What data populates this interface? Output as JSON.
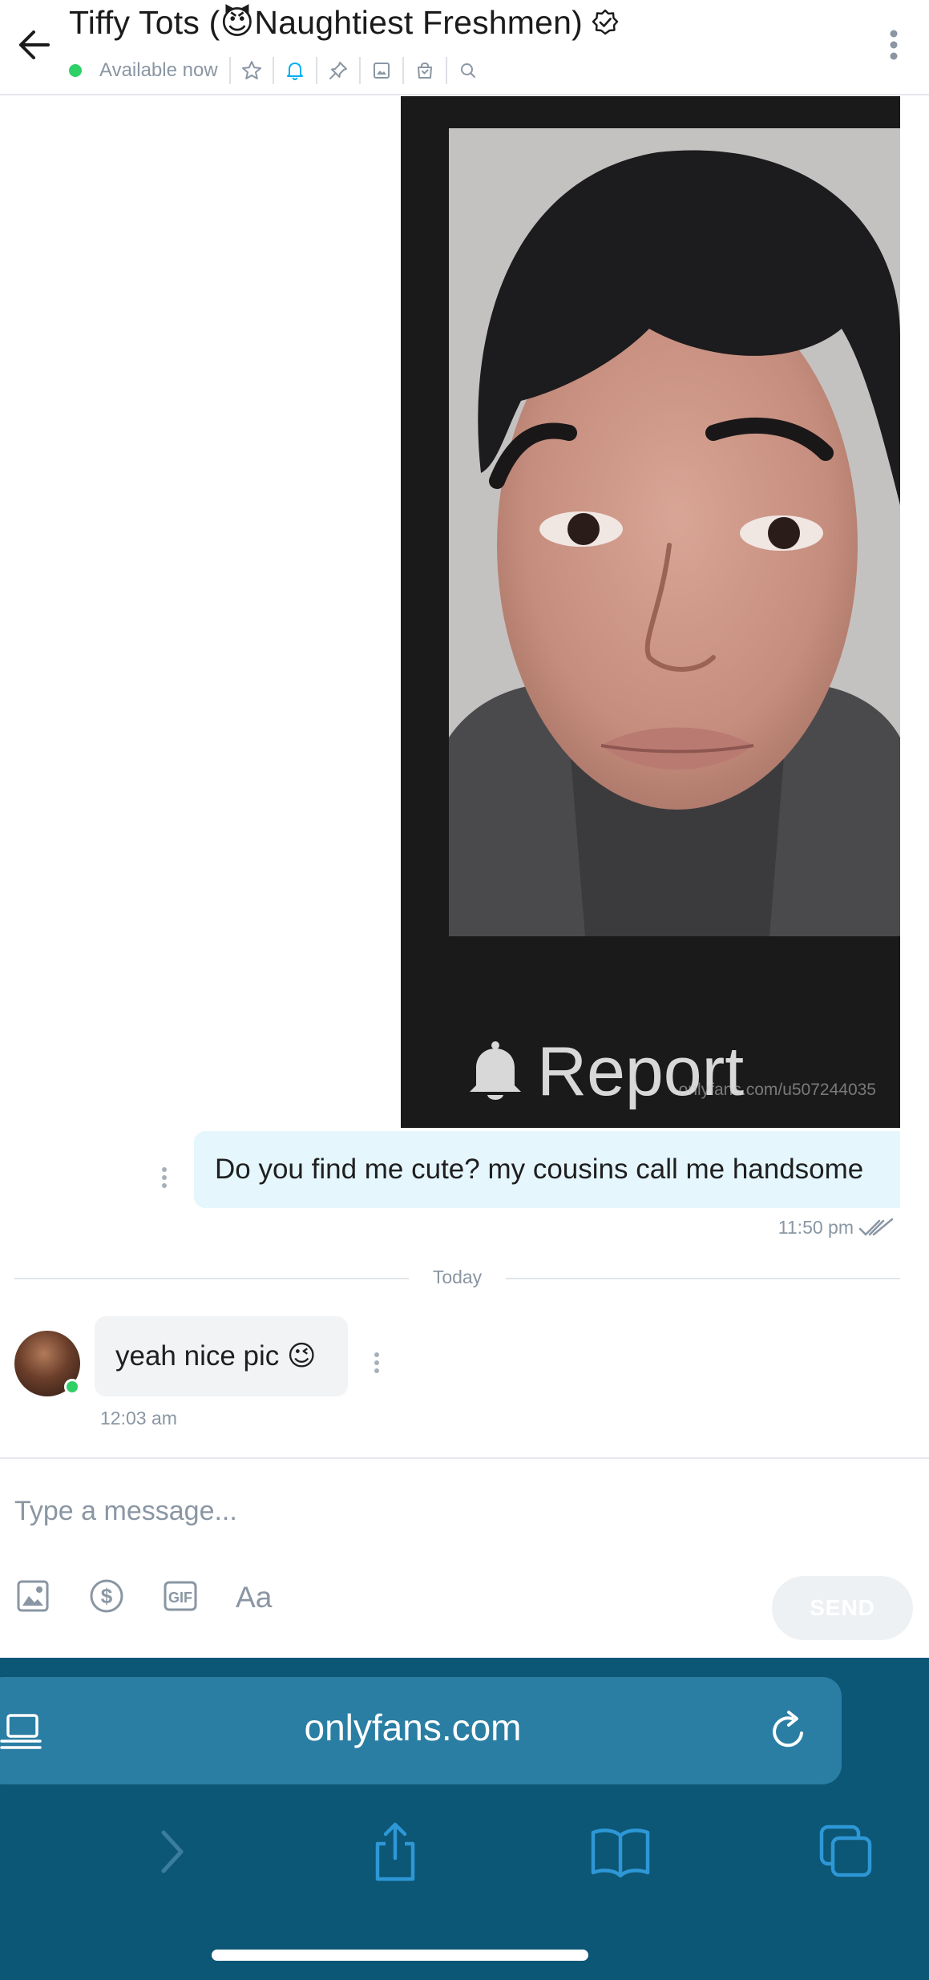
{
  "header": {
    "title": "Tiffy Tots (😈Naughtiest Freshmen)",
    "status": "Available now",
    "icons": [
      "back-arrow-icon",
      "verified-icon",
      "star-icon",
      "bell-icon",
      "pin-icon",
      "image-icon",
      "bag-icon",
      "search-icon",
      "more-vertical-icon"
    ],
    "accent_color": "#00aff0",
    "online_color": "#2fd066"
  },
  "chat": {
    "photo_message": {
      "report_label": "Report",
      "watermark": "onlyfans.com/u507244035"
    },
    "outgoing_message": {
      "text": "Do you find me cute? my cousins call me handsome",
      "time": "11:50 pm"
    },
    "day_divider": "Today",
    "incoming_message": {
      "text": "yeah nice pic 😉",
      "time": "12:03 am"
    }
  },
  "composer": {
    "placeholder": "Type a message...",
    "send_label": "SEND",
    "tools": [
      "image-icon",
      "dollar-icon",
      "gif-icon",
      "text-format-icon"
    ]
  },
  "browser": {
    "url": "onlyfans.com",
    "bar_color": "#0c5676"
  }
}
